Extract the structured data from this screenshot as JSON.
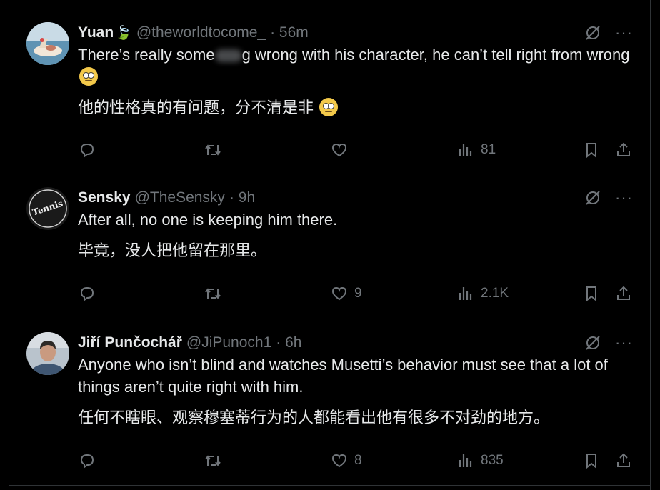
{
  "tweets": [
    {
      "name": "Yuan",
      "name_emoji": "🍃",
      "handle": "@theworldtocome_",
      "time": "· 56m",
      "text_part1": "There’s really some",
      "text_part2": "g wrong with his character, he can’t tell right from wrong",
      "text_cn": "他的性格真的有问题，分不清是非",
      "stats": {
        "replies": "",
        "retweets": "",
        "likes": "",
        "views": "81"
      }
    },
    {
      "name": "Sensky",
      "handle": "@TheSensky",
      "time": "· 9h",
      "text": "After all, no one is keeping him there.",
      "text_cn": "毕竟，没人把他留在那里。",
      "avatar_logo": "Tennis",
      "stats": {
        "replies": "",
        "retweets": "",
        "likes": "9",
        "views": "2.1K"
      }
    },
    {
      "name": "Jiří Punčochář",
      "handle": "@JiPunoch1",
      "time": "· 6h",
      "text": "Anyone who isn’t blind and watches Musetti’s behavior must see that a lot of things aren’t quite right with him.",
      "text_cn": "任何不瞎眼、观察穆塞蒂行为的人都能看出他有很多不对劲的地方。",
      "stats": {
        "replies": "",
        "retweets": "",
        "likes": "8",
        "views": "835"
      }
    }
  ],
  "icons": {
    "reply": "reply-icon",
    "retweet": "retweet-icon",
    "like": "heart-icon",
    "views": "views-icon",
    "bookmark": "bookmark-icon",
    "share": "share-icon",
    "grok": "grok-icon",
    "more": "more-icon"
  },
  "more_glyph": "···",
  "colors": {
    "background": "#000000",
    "text": "#e7e9ea",
    "secondary": "#71767b",
    "divider": "#2f3336"
  }
}
